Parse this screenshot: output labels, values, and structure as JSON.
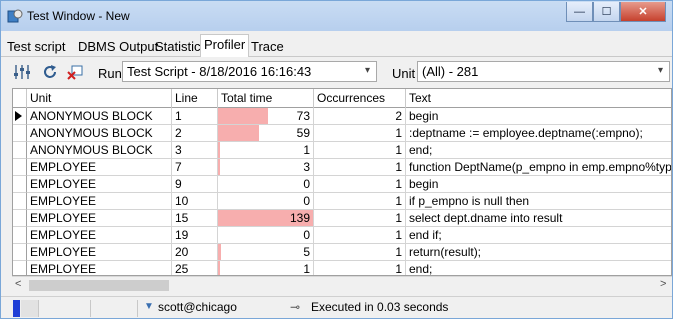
{
  "window": {
    "title": "Test Window - New"
  },
  "tabs": [
    {
      "label": "Test script"
    },
    {
      "label": "DBMS Output"
    },
    {
      "label": "Statistics"
    },
    {
      "label": "Profiler",
      "active": true
    },
    {
      "label": "Trace"
    }
  ],
  "toolbar": {
    "run_label": "Run",
    "run_value": "Test Script - 8/18/2016 16:16:43",
    "unit_label": "Unit",
    "unit_value": "(All) - 281"
  },
  "grid": {
    "columns": [
      "Unit",
      "Line",
      "Total time",
      "Occurrences",
      "Text"
    ],
    "max_time": 139,
    "rows": [
      {
        "unit": "ANONYMOUS BLOCK",
        "line": "1",
        "total_time": "73",
        "occurrences": "2",
        "text": "begin",
        "current": true
      },
      {
        "unit": "ANONYMOUS BLOCK",
        "line": "2",
        "total_time": "59",
        "occurrences": "1",
        "text": ":deptname := employee.deptname(:empno);"
      },
      {
        "unit": "ANONYMOUS BLOCK",
        "line": "3",
        "total_time": "1",
        "occurrences": "1",
        "text": "end;"
      },
      {
        "unit": "EMPLOYEE",
        "line": "7",
        "total_time": "3",
        "occurrences": "1",
        "text": "function DeptName(p_empno in emp.empno%type)"
      },
      {
        "unit": "EMPLOYEE",
        "line": "9",
        "total_time": "0",
        "occurrences": "1",
        "text": "begin"
      },
      {
        "unit": "EMPLOYEE",
        "line": "10",
        "total_time": "0",
        "occurrences": "1",
        "text": "if p_empno is null then"
      },
      {
        "unit": "EMPLOYEE",
        "line": "15",
        "total_time": "139",
        "occurrences": "1",
        "text": "select dept.dname into result"
      },
      {
        "unit": "EMPLOYEE",
        "line": "19",
        "total_time": "0",
        "occurrences": "1",
        "text": "end if;"
      },
      {
        "unit": "EMPLOYEE",
        "line": "20",
        "total_time": "5",
        "occurrences": "1",
        "text": "return(result);"
      },
      {
        "unit": "EMPLOYEE",
        "line": "25",
        "total_time": "1",
        "occurrences": "1",
        "text": "end;"
      }
    ]
  },
  "status": {
    "connection": "scott@chicago",
    "message": "Executed in 0.03 seconds"
  },
  "colors": {
    "time_bar": "#f7aeae",
    "title_bar": "#c9dcf3"
  }
}
